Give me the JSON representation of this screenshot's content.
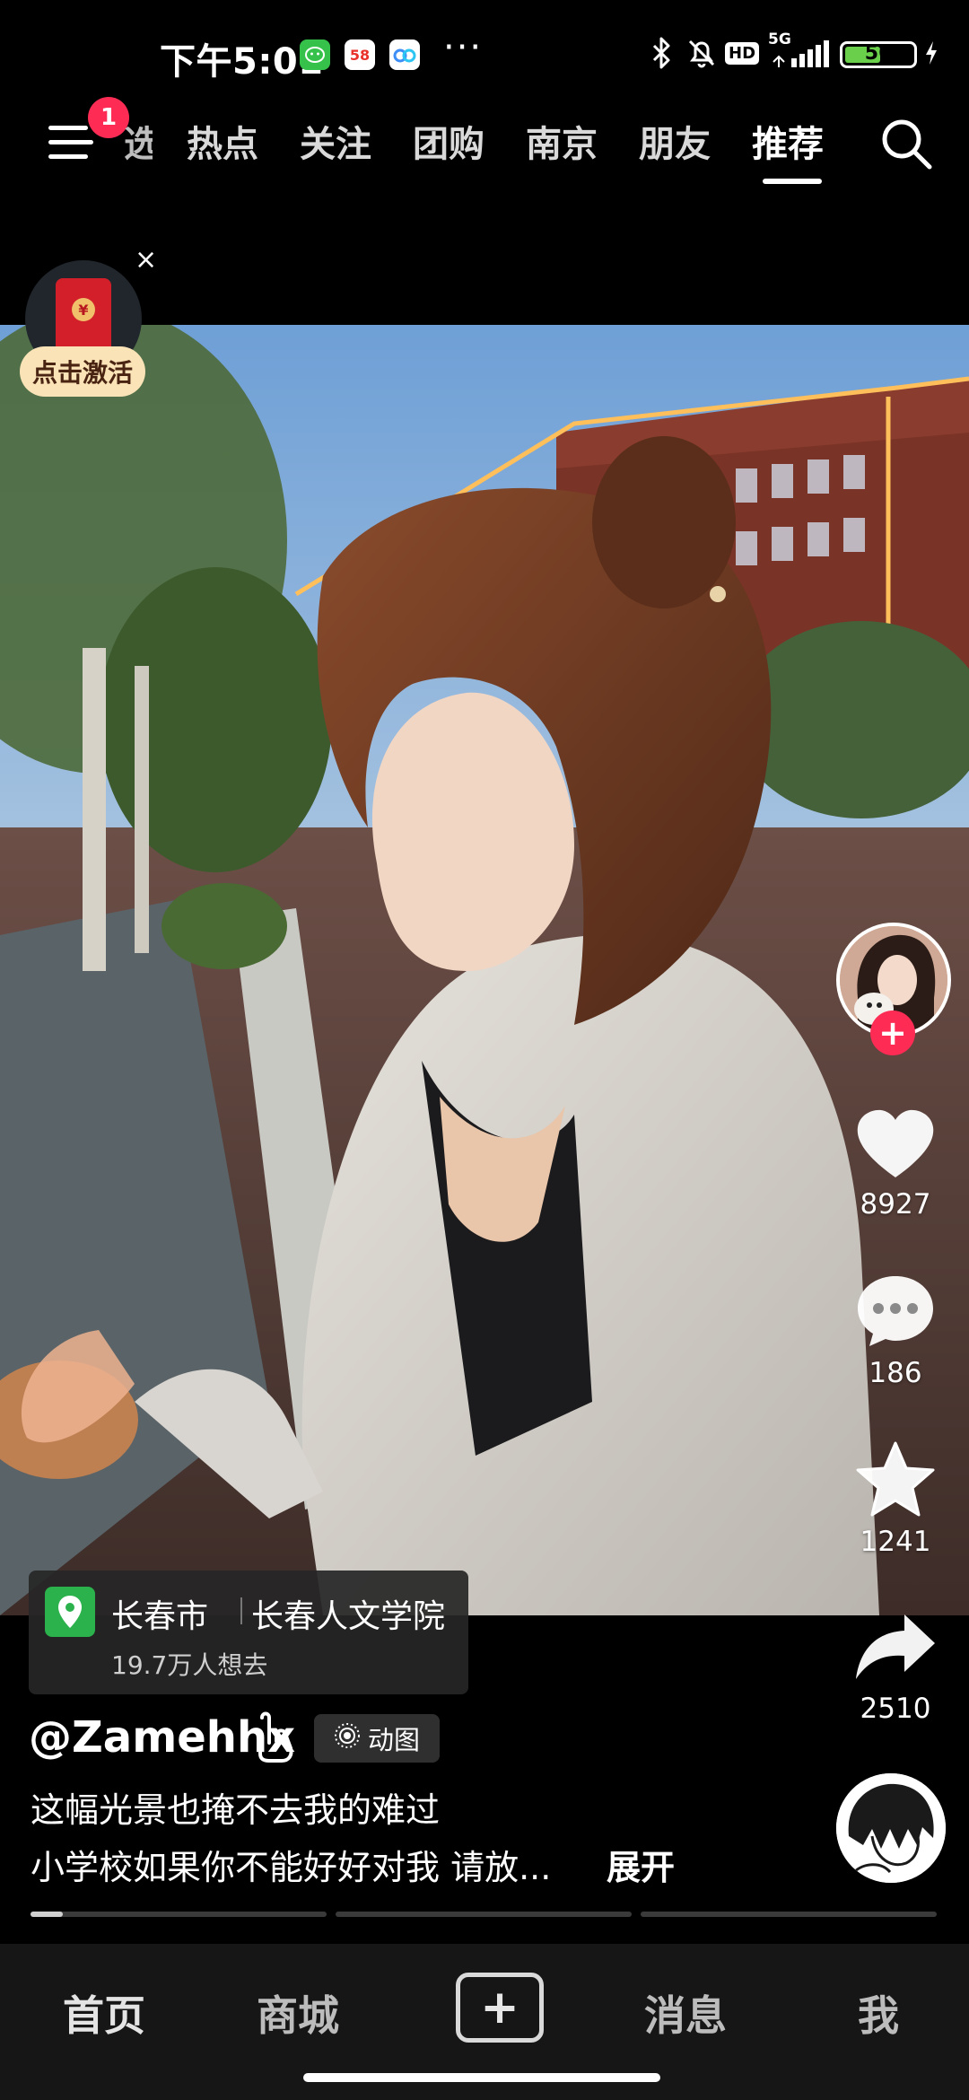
{
  "status_bar": {
    "time": "下午5:01",
    "app_icons": [
      "wechat-green-icon",
      "58-app-icon",
      "baidu-netdisk-icon"
    ],
    "more": "···",
    "network": "5G",
    "hd": "HD",
    "battery_level": "56"
  },
  "top_nav": {
    "menu_badge": "1",
    "tabs": [
      "热点",
      "关注",
      "团购",
      "南京",
      "朋友",
      "推荐"
    ],
    "partial_tab": "选",
    "active_tab": "推荐"
  },
  "activation_widget": {
    "label": "点击激活",
    "close": "×",
    "coin": "¥"
  },
  "right_rail": {
    "likes": "8927",
    "comments": "186",
    "favorites": "1241",
    "shares": "2510",
    "follow_icon": "+"
  },
  "location": {
    "city": "长春市",
    "poi": "长春人文学院",
    "subtitle": "19.7万人想去"
  },
  "video_info": {
    "author": "@Zamehhx",
    "tag": "动图",
    "caption_line1": "这幅光景也掩不去我的难过",
    "caption_line2": "小学校如果你不能好好对我 请放...",
    "expand": "展开"
  },
  "bottom_nav": {
    "items": [
      "首页",
      "商城",
      "消息",
      "我"
    ],
    "create_icon": "+"
  },
  "colors": {
    "accent_red": "#fe2c55",
    "location_green": "#2bb24c",
    "battery_green": "#6ad04c"
  }
}
